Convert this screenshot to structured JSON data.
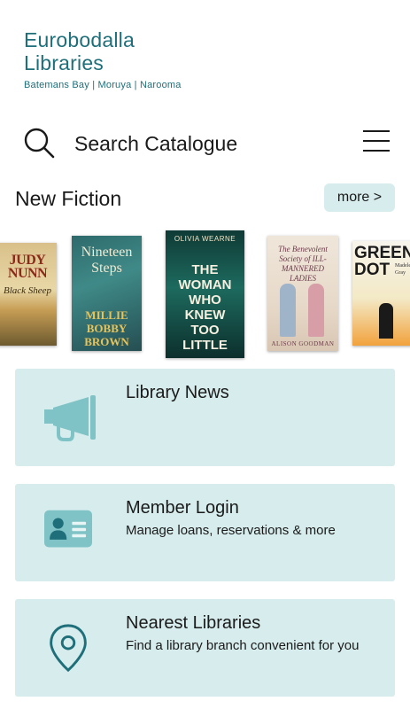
{
  "brand": {
    "line1": "Eurobodalla",
    "line2": "Libraries",
    "branches": "Batemans Bay | Moruya | Narooma",
    "color": "#1f6f7a"
  },
  "search": {
    "label": "Search Catalogue",
    "icon": "search-icon"
  },
  "menu": {
    "icon": "hamburger-menu-icon"
  },
  "new_fiction": {
    "title": "New Fiction",
    "more_label": "more >",
    "books": [
      {
        "author": "JUDY NUNN",
        "title": "Black Sheep"
      },
      {
        "title": "Nineteen Steps",
        "author": "MILLIE BOBBY BROWN"
      },
      {
        "author": "OLIVIA WEARNE",
        "title": "THE WOMAN WHO KNEW TOO LITTLE"
      },
      {
        "title": "The Benevolent Society of ILL-MANNERED LADIES",
        "author": "ALISON GOODMAN"
      },
      {
        "title": "GREEN DOT",
        "author": "Madeleine Gray"
      }
    ]
  },
  "cards": [
    {
      "title": "Library News",
      "desc": "",
      "icon": "megaphone-icon"
    },
    {
      "title": "Member Login",
      "desc": "Manage loans, reservations & more",
      "icon": "member-card-icon"
    },
    {
      "title": "Nearest Libraries",
      "desc": "Find a library branch convenient for you",
      "icon": "location-pin-icon"
    }
  ],
  "colors": {
    "card_bg": "#d7ecec",
    "icon_teal": "#7fc3c6",
    "pin_teal": "#1f6f7a"
  }
}
